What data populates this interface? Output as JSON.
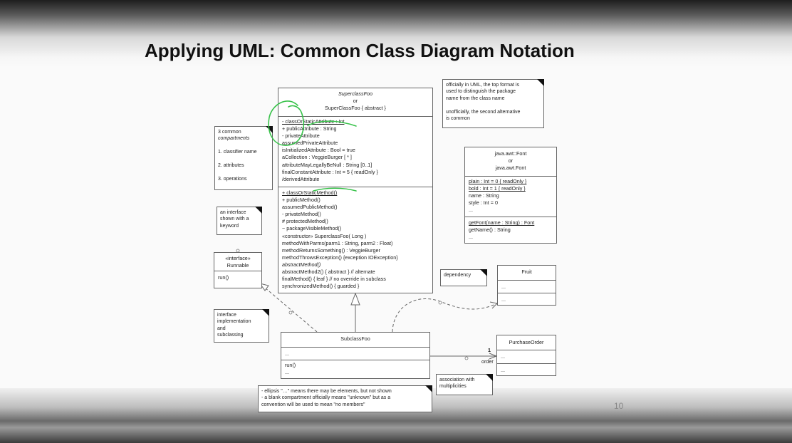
{
  "slide": {
    "title": "Applying UML: Common Class Diagram Notation",
    "page_number": "10"
  },
  "superclass": {
    "name_lines": [
      "SuperclassFoo",
      "or",
      "SuperClassFoo { abstract }"
    ],
    "attributes": [
      "- classOrStaticAttribute : Int",
      "+ publicAttribute : String",
      "- privateAttribute",
      "assumedPrivateAttribute",
      "isInitializedAttribute : Bool = true",
      "aCollection : VeggieBurger [ * ]",
      "attributeMayLegallyBeNull : String [0..1]",
      "finalConstantAttribute : Int = 5  { readOnly }",
      "/derivedAttribute"
    ],
    "operations": [
      "+ classOrStaticMethod()",
      "+ publicMethod()",
      "assumedPublicMethod()",
      "- privateMethod()",
      "# protectedMethod()",
      "~ packageVisibleMethod()",
      "«constructor» SuperclassFoo( Long )",
      "methodWithParms(parm1 : String, parm2 : Float)",
      "methodReturnsSomething() : VeggieBurger",
      "methodThrowsException() {exception IOException}",
      "abstractMethod()",
      "abstractMethod2() { abstract }   // alternate",
      "finalMethod() { leaf }   // no override in subclass",
      "synchronizedMethod() { guarded }"
    ]
  },
  "notes": {
    "compartments": [
      "3 common",
      "compartments",
      "",
      "1. classifier name",
      "",
      "2. attributes",
      "",
      "3. operations"
    ],
    "official": [
      "officially in UML, the top format is",
      "used to distinguish the package",
      "name from the class name",
      "",
      "unofficially, the second alternative",
      "is common"
    ],
    "interface_keyword": [
      "an interface",
      "shown with a",
      "keyword"
    ],
    "interface_impl": [
      "interface",
      "implementation",
      "and",
      "subclassing"
    ],
    "dependency": [
      "dependency"
    ],
    "association": [
      "association with",
      "multiplicities"
    ],
    "ellipsis": [
      "- ellipsis \"…\" means there may be elements, but not shown",
      "- a blank compartment officially means \"unknown\" but as a",
      "convention will be used to mean \"no members\""
    ]
  },
  "font_class": {
    "name_lines": [
      "java.awt::Font",
      "or",
      "java.awt.Font"
    ],
    "attributes": [
      "plain : Int = 0 { readOnly }",
      "bold : Int = 1 { readOnly }",
      "name : String",
      "style : Int = 0",
      "..."
    ],
    "operations": [
      "getFont(name : String) : Font",
      "getName() : String",
      "..."
    ]
  },
  "runnable": {
    "name_lines": [
      "«interface»",
      "Runnable"
    ],
    "operations": [
      "run()"
    ]
  },
  "fruit": {
    "name": "Fruit",
    "attributes": [
      "..."
    ],
    "operations": [
      "..."
    ]
  },
  "subclass": {
    "name": "SubclassFoo",
    "attributes": [
      "..."
    ],
    "operations": [
      "run()",
      "..."
    ]
  },
  "purchase_order": {
    "name": "PurchaseOrder",
    "attributes": [
      "..."
    ],
    "operations": [
      "..."
    ]
  },
  "association": {
    "multiplicity": "1",
    "role": "order"
  },
  "colors": {
    "annotation_green": "#38c24a",
    "line": "#666666"
  }
}
